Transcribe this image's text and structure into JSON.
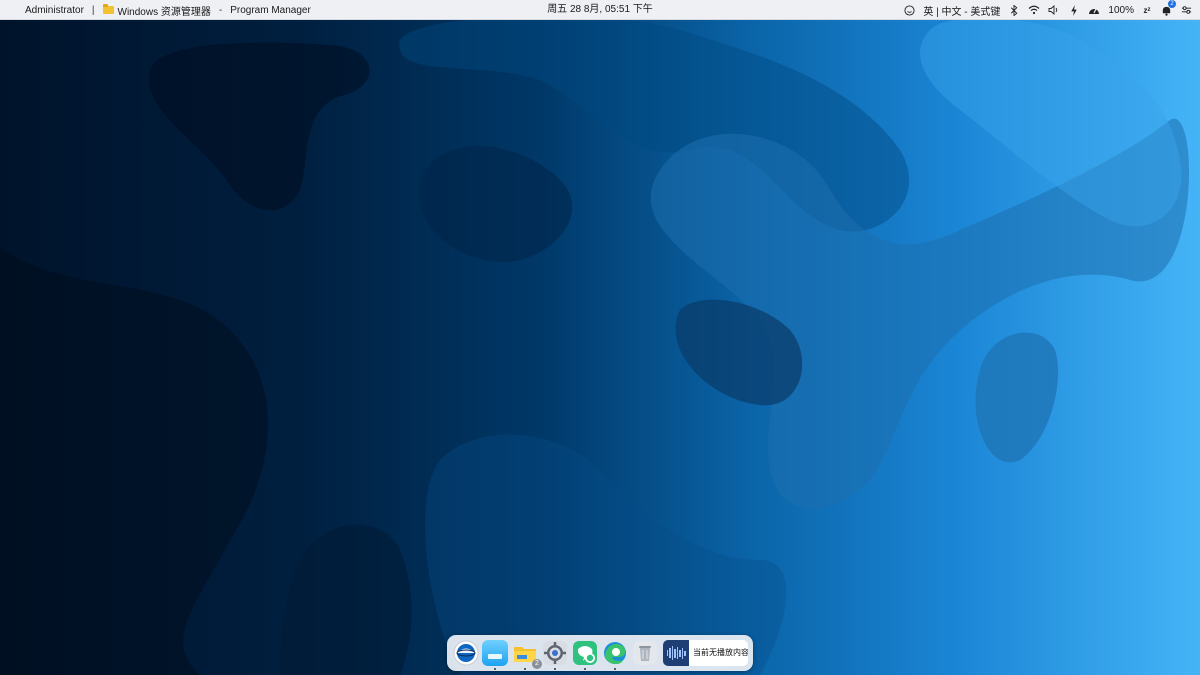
{
  "menubar": {
    "user": "Administrator",
    "divider": "|",
    "app_name": "Windows 资源管理器",
    "dash": "-",
    "window_title": "Program Manager",
    "clock": "周五 28 8月, 05:51 下午",
    "input_method": "英 | 中文 - 美式键",
    "battery": "100%",
    "notification_count": "2",
    "icons": [
      "emoji-smile-icon",
      "bluetooth-icon",
      "wifi-icon",
      "volume-icon",
      "charging-icon",
      "gauge-icon",
      "sleep-icon",
      "notification-bell-icon",
      "settings-toggle-icon"
    ]
  },
  "dock": {
    "items": [
      {
        "name": "finder-app",
        "icon": "globe-eye-icon",
        "running": false
      },
      {
        "name": "launchpad-app",
        "icon": "window-icon",
        "running": true
      },
      {
        "name": "file-explorer-app",
        "icon": "folder-icon",
        "running": true,
        "badge": "2"
      },
      {
        "name": "settings-app",
        "icon": "gear-icon",
        "running": true
      },
      {
        "name": "wechat-app",
        "icon": "chat-icon",
        "running": true
      },
      {
        "name": "edge-browser-app",
        "icon": "edge-icon",
        "running": true
      },
      {
        "name": "recycle-bin-app",
        "icon": "trash-icon",
        "running": false
      }
    ],
    "media_text": "当前无播放内容"
  },
  "colors": {
    "menubar_bg": "#eef0f4",
    "dock_bg": "#ecf0f6",
    "wallpaper_dark": "#00132b",
    "wallpaper_light": "#45b4f7"
  }
}
